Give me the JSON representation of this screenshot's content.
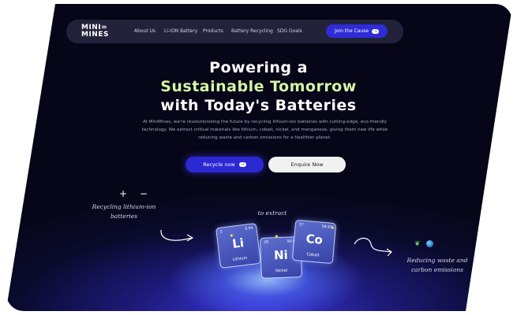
{
  "nav": {
    "logo_line1": "MINI∞",
    "logo_line2": "MINES",
    "links": [
      "About Us",
      "Li-ION Battery",
      "Products",
      "Battery Recycling",
      "SDG Goals"
    ],
    "cta": "Join the Cause"
  },
  "hero": {
    "line1": "Powering a",
    "line2": "Sustainable Tomorrow",
    "line3": "with Today's Batteries",
    "description": "At MiniMines, we're revolutionizing the future by recycling lithium-ion batteries with cutting-edge, eco-friendly technology. We extract critical materials like lithium, cobalt, nickel, and manganese, giving them new life while reducing waste and carbon emissions for a healthier planet.",
    "primary_button": "Recycle now",
    "secondary_button": "Enquire Now"
  },
  "illustration": {
    "plus_minus": "+ −",
    "recycling_label_1": "Recycling lithium-ion",
    "recycling_label_2": "batteries",
    "extract_label": "to extract",
    "reducing_label_1": "Reducing waste and",
    "reducing_label_2": "carbon emissions",
    "elements": [
      {
        "number": "3",
        "mass": "6.94",
        "symbol": "Li",
        "name": "Lithium"
      },
      {
        "number": "28",
        "mass": "58.69",
        "symbol": "Ni",
        "name": "Nickel"
      },
      {
        "number": "27",
        "mass": "58.93",
        "symbol": "Co",
        "name": "Cobalt"
      }
    ]
  },
  "colors": {
    "accent": "#2f2bd8",
    "headline_green": "#d6f5a5",
    "background": "#0a0a2c"
  },
  "icons": [
    "arrow-right-icon",
    "sprout-icon",
    "globe-icon",
    "sparkle-icon",
    "curved-arrow-icon"
  ]
}
